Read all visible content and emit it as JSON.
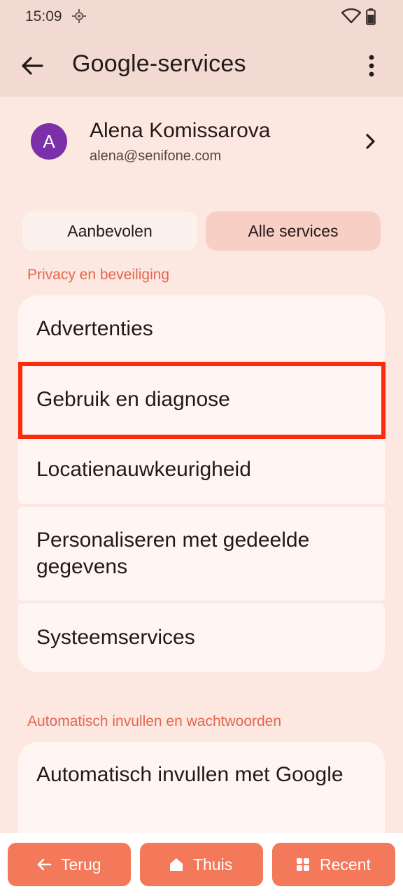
{
  "status_bar": {
    "time": "15:09",
    "icons": [
      "location-icon",
      "wifi-icon",
      "battery-icon"
    ]
  },
  "app_bar": {
    "title": "Google-services",
    "back_icon": "arrow-left-icon",
    "menu_icon": "more-vert-icon"
  },
  "account": {
    "avatar_letter": "A",
    "avatar_color": "#7b2fa8",
    "name": "Alena Komissarova",
    "email": "alena@senifone.com"
  },
  "tabs": [
    {
      "label": "Aanbevolen",
      "selected": false
    },
    {
      "label": "Alle services",
      "selected": true
    }
  ],
  "sections": [
    {
      "title": "Privacy en beveiliging",
      "items": [
        "Advertenties",
        "Gebruik en diagnose",
        "Locatienauwkeurigheid",
        "Personaliseren met gedeelde gegevens",
        "Systeemservices"
      ]
    },
    {
      "title": "Automatisch invullen en wachtwoorden",
      "items": [
        "Automatisch invullen met Google"
      ]
    }
  ],
  "highlighted_item": "Gebruik en diagnose",
  "nav_buttons": [
    {
      "label": "Terug",
      "icon": "arrow-left-icon"
    },
    {
      "label": "Thuis",
      "icon": "home-icon"
    },
    {
      "label": "Recent",
      "icon": "apps-grid-icon"
    }
  ],
  "colors": {
    "accent": "#e2674e",
    "nav_button": "#f4785a",
    "highlight": "#ff2a0a",
    "background": "#fde7e1"
  }
}
